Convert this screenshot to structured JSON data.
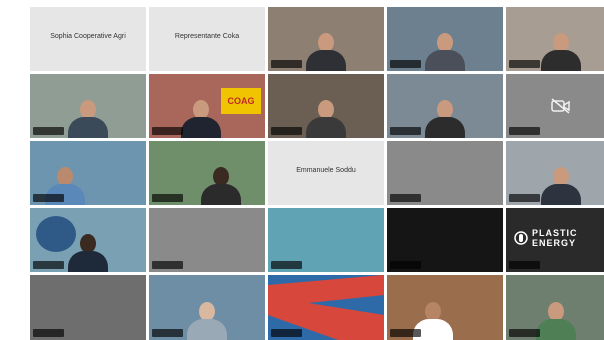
{
  "meeting": {
    "title_tiles": [
      {
        "index": 0,
        "label": "Sophia Cooperative Agri"
      },
      {
        "index": 1,
        "label": "Representante Coka"
      },
      {
        "index": 12,
        "label": "Emmanuele Soddu"
      }
    ],
    "participants": [
      {
        "index": 0,
        "kind": "title",
        "bg": "light"
      },
      {
        "index": 1,
        "kind": "title",
        "bg": "light"
      },
      {
        "index": 2,
        "kind": "video",
        "bg": "#8d7f72"
      },
      {
        "index": 3,
        "kind": "video",
        "bg": "#6d8090"
      },
      {
        "index": 4,
        "kind": "video",
        "bg": "#a89d93"
      },
      {
        "index": 5,
        "kind": "video",
        "bg": "#8f9d94"
      },
      {
        "index": 6,
        "kind": "video",
        "bg": "#a9665a"
      },
      {
        "index": 7,
        "kind": "video",
        "bg": "#6b5e53"
      },
      {
        "index": 8,
        "kind": "video",
        "bg": "#7b8a94"
      },
      {
        "index": 9,
        "kind": "camera-off",
        "bg": "grey"
      },
      {
        "index": 10,
        "kind": "video",
        "bg": "#6d95b0"
      },
      {
        "index": 11,
        "kind": "video",
        "bg": "#6f8f6b"
      },
      {
        "index": 12,
        "kind": "title",
        "bg": "light"
      },
      {
        "index": 13,
        "kind": "empty",
        "bg": "grey"
      },
      {
        "index": 14,
        "kind": "video",
        "bg": "#9fa6ab"
      },
      {
        "index": 15,
        "kind": "video",
        "bg": "#7aa0b4"
      },
      {
        "index": 16,
        "kind": "empty",
        "bg": "grey"
      },
      {
        "index": 17,
        "kind": "empty",
        "bg": "teal"
      },
      {
        "index": 18,
        "kind": "empty",
        "bg": "dark"
      },
      {
        "index": 19,
        "kind": "logo",
        "bg": "black"
      },
      {
        "index": 20,
        "kind": "empty",
        "bg": "grey"
      },
      {
        "index": 21,
        "kind": "video",
        "bg": "#6e8ea6"
      },
      {
        "index": 22,
        "kind": "graphic",
        "bg": "#c8463a"
      },
      {
        "index": 23,
        "kind": "video",
        "bg": "#9a6d4c"
      },
      {
        "index": 24,
        "kind": "video",
        "bg": "#6f7f6f"
      }
    ],
    "logo_tile": {
      "line1": "PLASTIC",
      "line2": "ENERGY"
    },
    "banner_tile": {
      "text": "COAG"
    }
  }
}
